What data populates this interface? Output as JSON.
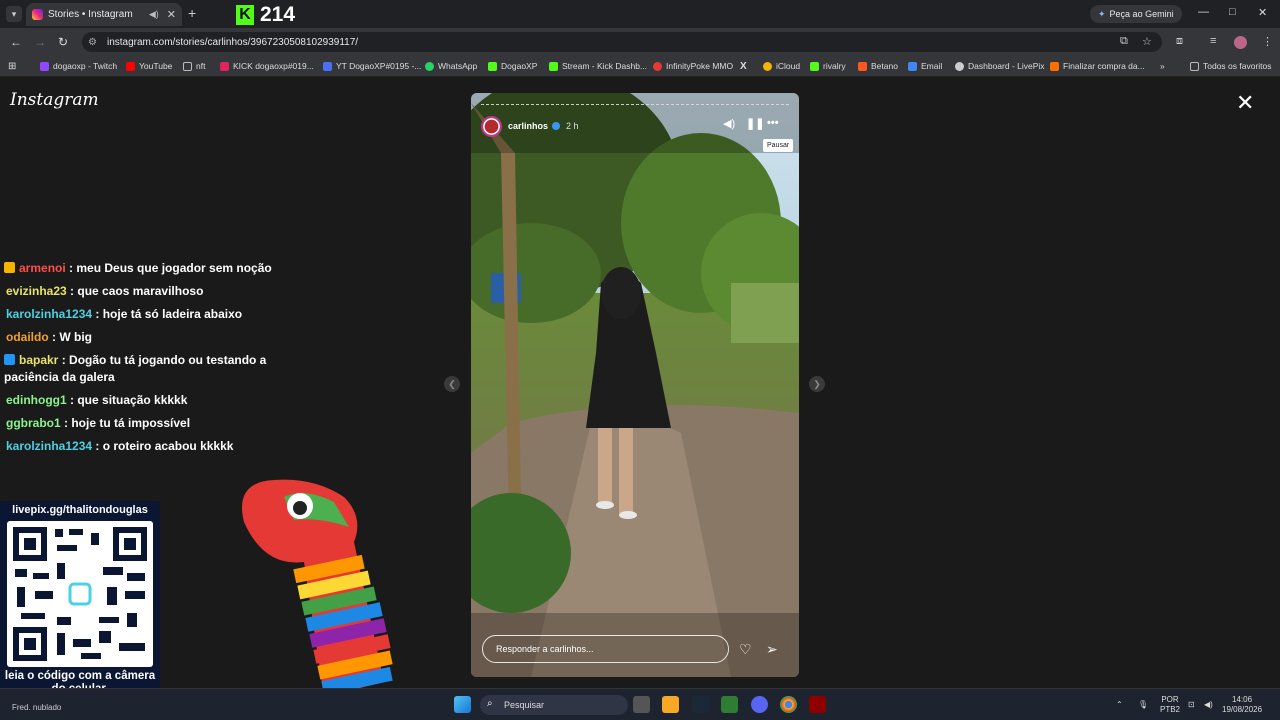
{
  "browser": {
    "tab": {
      "title": "Stories • Instagram",
      "close_glyph": "✕",
      "audio_icon": "speaker-icon"
    },
    "new_tab_glyph": "+",
    "gemini_label": "Peça ao Gemini",
    "address": "instagram.com/stories/carlinhos/3967230508102939117/",
    "window_controls": {
      "minimize": "—",
      "maximize": "□",
      "close": "✕"
    }
  },
  "kick_overlay": {
    "logo": "K",
    "viewers": "214"
  },
  "bookmarks": [
    {
      "label": "dogaoxp - Twitch",
      "color": "#9146ff"
    },
    {
      "label": "YouTube",
      "color": "#ff0000"
    },
    {
      "label": "nft",
      "color": "#bbbbbb"
    },
    {
      "label": "KICK dogaoxp#019...",
      "color": "#e0245e"
    },
    {
      "label": "YT DogaoXP#0195 -...",
      "color": "#4c6ef5"
    },
    {
      "label": "WhatsApp",
      "color": "#25d366"
    },
    {
      "label": "DogaoXP",
      "color": "#53fc18"
    },
    {
      "label": "Stream - Kick Dashb...",
      "color": "#53fc18"
    },
    {
      "label": "InfinityPoke MMO",
      "color": "#e53935"
    },
    {
      "label": "X",
      "color": "#ffffff"
    },
    {
      "label": "iCloud",
      "color": "#f4b400"
    },
    {
      "label": "rivalry",
      "color": "#53fc18"
    },
    {
      "label": "Betano",
      "color": "#ff5722"
    },
    {
      "label": "Email",
      "color": "#4285f4"
    },
    {
      "label": "Dashboard - LivePix",
      "color": "#cccccc"
    },
    {
      "label": "Finalizar compra da...",
      "color": "#ff6f00"
    }
  ],
  "bookmarks_more": "»",
  "all_favorites": "Todos os favoritos",
  "instagram": {
    "logo": "Instagram",
    "close_glyph": "✕",
    "story": {
      "username": "carlinhos",
      "time": "2 h",
      "tooltip": "Pausar",
      "reply_placeholder": "Responder a carlinhos..."
    }
  },
  "chat": [
    {
      "user": "armenoi",
      "text": ": meu Deus que jogador sem noção",
      "color": "#ff4d4d",
      "badge": "#f4b400"
    },
    {
      "user": "evizinha23",
      "text": ": que caos maravilhoso",
      "color": "#e8e36a",
      "badge": ""
    },
    {
      "user": "karolzinha1234",
      "text": ": hoje tá só ladeira abaixo",
      "color": "#4dd0e1",
      "badge": ""
    },
    {
      "user": "odaildo",
      "text": ": W big",
      "color": "#f0a030",
      "badge": ""
    },
    {
      "user": "bapakr",
      "text": ": Dogão tu tá jogando ou testando a paciência da galera",
      "color": "#e8e36a",
      "badge": "#2196f3"
    },
    {
      "user": "edinhogg1",
      "text": ": que situação kkkkk",
      "color": "#8bf58b",
      "badge": ""
    },
    {
      "user": "ggbrabo1",
      "text": ": hoje tu tá impossível",
      "color": "#8bf58b",
      "badge": ""
    },
    {
      "user": "karolzinha1234",
      "text": ": o roteiro acabou kkkkk",
      "color": "#4dd0e1",
      "badge": ""
    }
  ],
  "livepix": {
    "url": "livepix.gg/thalitondouglas",
    "caption": "leia o código com a câmera do celular."
  },
  "taskbar": {
    "weather": "Fred. nublado",
    "search_placeholder": "Pesquisar",
    "lang": "POR",
    "lang2": "PTB2",
    "time": "14:06",
    "date": "19/08/2026"
  }
}
